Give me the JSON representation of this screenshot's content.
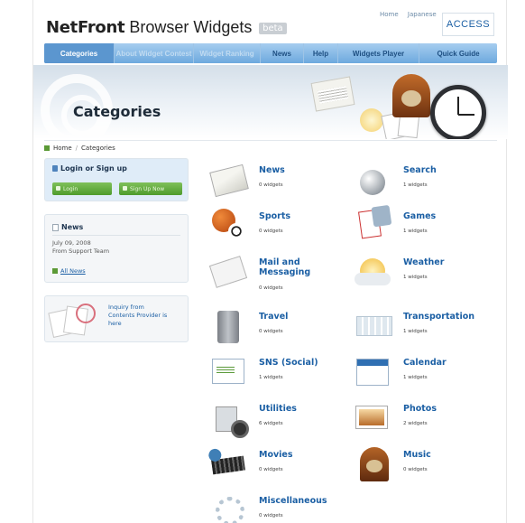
{
  "header": {
    "logo_brand": "NetFront",
    "logo_title": "Browser Widgets",
    "beta_label": "beta",
    "top_links": [
      "Home",
      "Japanese"
    ],
    "access_logo": "ACCESS"
  },
  "nav": {
    "tabs": [
      {
        "label": "Categories",
        "state": "active"
      },
      {
        "label": "About Widget Contest",
        "state": "faded"
      },
      {
        "label": "Widget Ranking",
        "state": "faded"
      },
      {
        "label": "News",
        "state": "normal"
      },
      {
        "label": "Help",
        "state": "normal"
      },
      {
        "label": "Widgets Player",
        "state": "normal"
      },
      {
        "label": "Quick Guide",
        "state": "normal"
      }
    ]
  },
  "hero": {
    "title": "Categories"
  },
  "breadcrumb": {
    "home": "Home",
    "separator": "/",
    "current": "Categories"
  },
  "sidebar": {
    "login": {
      "title": "Login or Sign up",
      "login_button": "Login",
      "signup_button": "Sign Up Now"
    },
    "news": {
      "title": "News",
      "date": "July 09, 2008",
      "from": "From Support Team",
      "all_news": "All News"
    },
    "inquiry": {
      "text_line1": "Inquiry from",
      "text_line2": "Contents Provider is",
      "text_line3": "here"
    }
  },
  "categories": [
    {
      "name": "News",
      "count": "0 widgets",
      "icon": "newspaper-icon"
    },
    {
      "name": "Search",
      "count": "1 widgets",
      "icon": "magnifier-icon"
    },
    {
      "name": "Sports",
      "count": "0 widgets",
      "icon": "sports-balls-icon"
    },
    {
      "name": "Games",
      "count": "1 widgets",
      "icon": "playing-cards-icon"
    },
    {
      "name": "Mail and\nMessaging",
      "count": "0 widgets",
      "icon": "envelopes-icon"
    },
    {
      "name": "Weather",
      "count": "1 widgets",
      "icon": "sun-cloud-icon"
    },
    {
      "name": "Travel",
      "count": "0 widgets",
      "icon": "suitcase-icon"
    },
    {
      "name": "Transportation",
      "count": "1 widgets",
      "icon": "train-icon"
    },
    {
      "name": "SNS (Social)",
      "count": "1 widgets",
      "icon": "notebook-icon"
    },
    {
      "name": "Calendar",
      "count": "1 widgets",
      "icon": "calendar-icon"
    },
    {
      "name": "Utilities",
      "count": "6 widgets",
      "icon": "calculator-icon"
    },
    {
      "name": "Photos",
      "count": "2 widgets",
      "icon": "photo-icon"
    },
    {
      "name": "Movies",
      "count": "0 widgets",
      "icon": "film-reel-icon"
    },
    {
      "name": "Music",
      "count": "0 widgets",
      "icon": "radio-icon"
    },
    {
      "name": "Miscellaneous",
      "count": "0 widgets",
      "icon": "gears-icon"
    }
  ]
}
